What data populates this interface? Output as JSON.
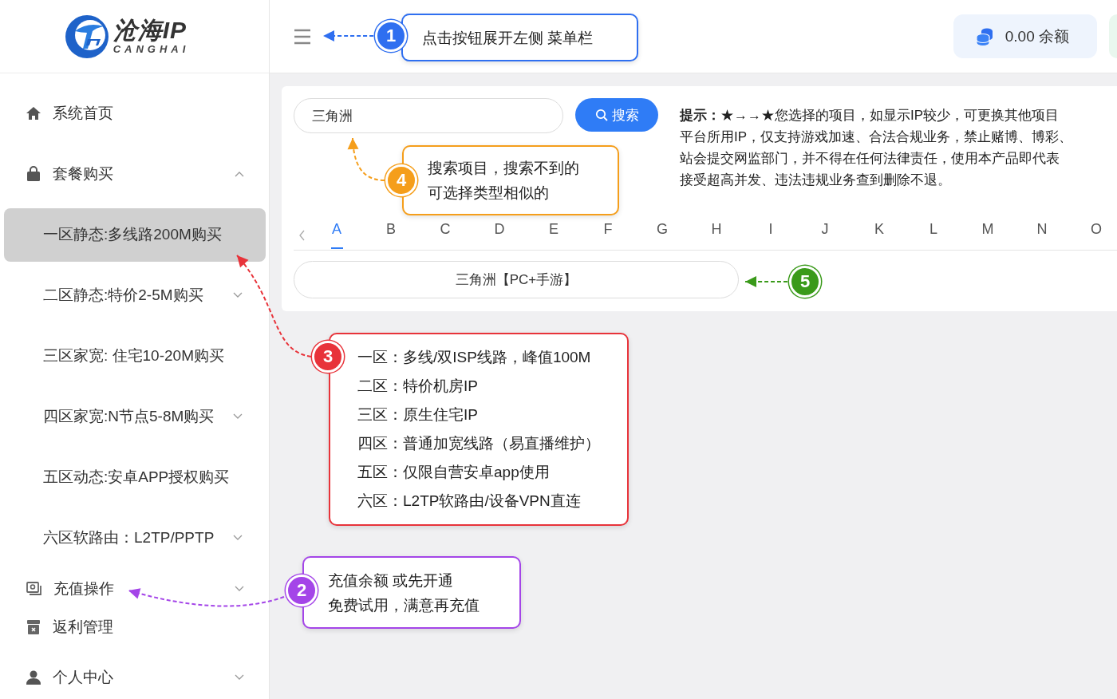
{
  "sidebar": {
    "logo": {
      "name": "沧海IP",
      "subtitle": "CANGHAI"
    },
    "items": [
      {
        "label": "系统首页",
        "selected": false
      },
      {
        "label": "套餐购买",
        "selected": false,
        "expanded": true,
        "children": [
          {
            "label": "一区静态:多线路200M购买",
            "selected": true
          },
          {
            "label": "二区静态:特价2-5M购买",
            "selected": false,
            "expanded": false
          },
          {
            "label": "三区家宽: 住宅10-20M购买",
            "selected": false
          },
          {
            "label": "四区家宽:N节点5-8M购买",
            "selected": false,
            "expanded": false
          },
          {
            "label": "五区动态:安卓APP授权购买",
            "selected": false
          },
          {
            "label": "六区软路由：L2TP/PPTP",
            "selected": false,
            "expanded": false
          }
        ]
      },
      {
        "label": "充值操作",
        "selected": false,
        "expanded": false
      },
      {
        "label": "返利管理",
        "selected": false
      },
      {
        "label": "个人中心",
        "selected": false,
        "expanded": false
      }
    ]
  },
  "header": {
    "balance": {
      "amount": "0.00",
      "label": "余额"
    }
  },
  "search": {
    "value": "三角洲",
    "button": "搜索"
  },
  "hint": {
    "lines": [
      "**提示：**★→→★您选择的项目，如显示IP较少，可更换其他项目",
      "平台所用IP，仅支持游戏加速、合法合规业务，禁止赌博、博彩、",
      "站会提交网监部门，并不得在任何法律责任，使用本产品即代表",
      "接受超高并发、违法违规业务查到删除不退。"
    ]
  },
  "letter_tabs": [
    {
      "label": "A",
      "selected": true
    },
    {
      "label": "B",
      "selected": false
    },
    {
      "label": "C",
      "selected": false
    },
    {
      "label": "D",
      "selected": false
    },
    {
      "label": "E",
      "selected": false
    },
    {
      "label": "F",
      "selected": false
    },
    {
      "label": "G",
      "selected": false
    },
    {
      "label": "H",
      "selected": false
    },
    {
      "label": "I",
      "selected": false
    },
    {
      "label": "J",
      "selected": false
    },
    {
      "label": "K",
      "selected": false
    },
    {
      "label": "L",
      "selected": false
    },
    {
      "label": "M",
      "selected": false
    },
    {
      "label": "N",
      "selected": false
    },
    {
      "label": "O",
      "selected": false
    }
  ],
  "results": [
    {
      "label": "三角洲【PC+手游】"
    }
  ],
  "annotations": [
    {
      "number": "1",
      "color": "#2f6ff0",
      "lines": [
        "点击按钮展开左侧 菜单栏"
      ]
    },
    {
      "number": "4",
      "color": "#f59e1b",
      "lines": [
        "搜索项目，搜索不到的",
        "可选择类型相似的"
      ]
    },
    {
      "number": "5",
      "color": "#3a9a1a"
    },
    {
      "number": "3",
      "color": "#e8333a",
      "lines": [
        "一区：多线/双ISP线路，峰值100M",
        "二区：特价机房IP",
        "三区：原生住宅IP",
        "四区：普通加宽线路（易直播维护）",
        "五区：仅限自营安卓app使用",
        "六区：L2TP软路由/设备VPN直连"
      ]
    },
    {
      "number": "2",
      "color": "#a445e8",
      "lines": [
        "充值余额 或先开通",
        "免费试用，满意再充值"
      ]
    }
  ]
}
